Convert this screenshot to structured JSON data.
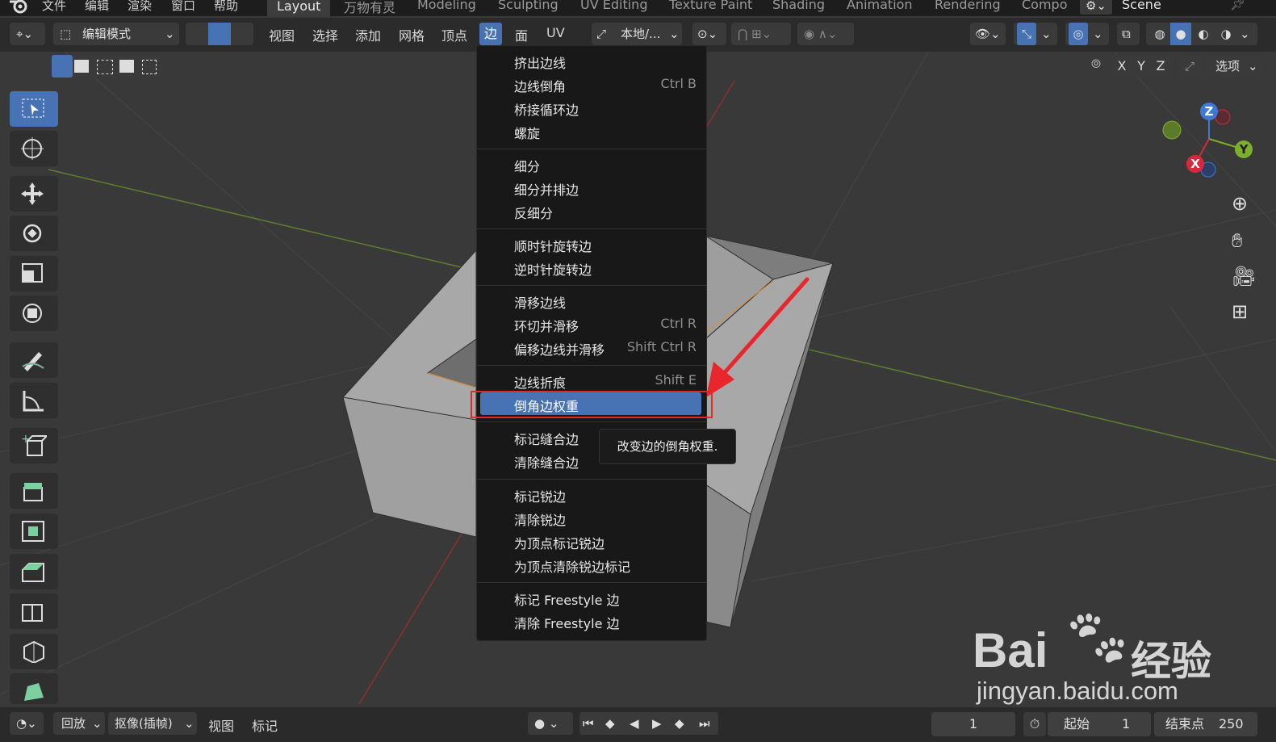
{
  "topbar": {
    "menus": [
      "文件",
      "编辑",
      "渲染",
      "窗口",
      "帮助"
    ],
    "workspaces": [
      "Layout",
      "万物有灵",
      "Modeling",
      "Sculpting",
      "UV Editing",
      "Texture Paint",
      "Shading",
      "Animation",
      "Rendering",
      "Compo"
    ],
    "active_workspace": "Layout",
    "scene": "Scene"
  },
  "header": {
    "mode": "编辑模式",
    "menus": [
      "视图",
      "选择",
      "添加",
      "网格",
      "顶点",
      "边",
      "面",
      "UV"
    ],
    "active_menu": "边",
    "transform_orientation": "本地/...",
    "options_label": "选项",
    "axes": [
      "X",
      "Y",
      "Z"
    ]
  },
  "edge_menu": {
    "items": [
      {
        "label": "挤出边线",
        "shortcut": ""
      },
      {
        "label": "边线倒角",
        "shortcut": "Ctrl B"
      },
      {
        "label": "桥接循环边",
        "shortcut": ""
      },
      {
        "label": "螺旋",
        "shortcut": ""
      },
      {
        "label": "细分",
        "shortcut": ""
      },
      {
        "label": "细分并排边",
        "shortcut": ""
      },
      {
        "label": "反细分",
        "shortcut": ""
      },
      {
        "label": "顺时针旋转边",
        "shortcut": ""
      },
      {
        "label": "逆时针旋转边",
        "shortcut": ""
      },
      {
        "label": "滑移边线",
        "shortcut": ""
      },
      {
        "label": "环切并滑移",
        "shortcut": "Ctrl R"
      },
      {
        "label": "偏移边线并滑移",
        "shortcut": "Shift Ctrl R"
      },
      {
        "label": "边线折痕",
        "shortcut": "Shift E"
      },
      {
        "label": "倒角边权重",
        "shortcut": ""
      },
      {
        "label": "标记缝合边",
        "shortcut": ""
      },
      {
        "label": "清除缝合边",
        "shortcut": ""
      },
      {
        "label": "标记锐边",
        "shortcut": ""
      },
      {
        "label": "清除锐边",
        "shortcut": ""
      },
      {
        "label": "为顶点标记锐边",
        "shortcut": ""
      },
      {
        "label": "为顶点清除锐边标记",
        "shortcut": ""
      },
      {
        "label": "标记 Freestyle 边",
        "shortcut": ""
      },
      {
        "label": "清除 Freestyle 边",
        "shortcut": ""
      }
    ],
    "highlighted": "倒角边权重",
    "tooltip": "改变边的倒角权重."
  },
  "gizmo": {
    "x": "X",
    "y": "Y",
    "z": "Z"
  },
  "timeline": {
    "playback": "回放",
    "keying": "抠像(插帧)",
    "view": "视图",
    "marker": "标记",
    "current_frame": "1",
    "start_label": "起始",
    "start": "1",
    "end_label": "结束点",
    "end": "250"
  },
  "watermark": {
    "site": "jingyan.baidu.com",
    "brand": "Bai",
    "brand2": "经验"
  },
  "colors": {
    "accent": "#4772b3",
    "highlight_box": "#e02a2a",
    "arrow": "#e8262c"
  }
}
